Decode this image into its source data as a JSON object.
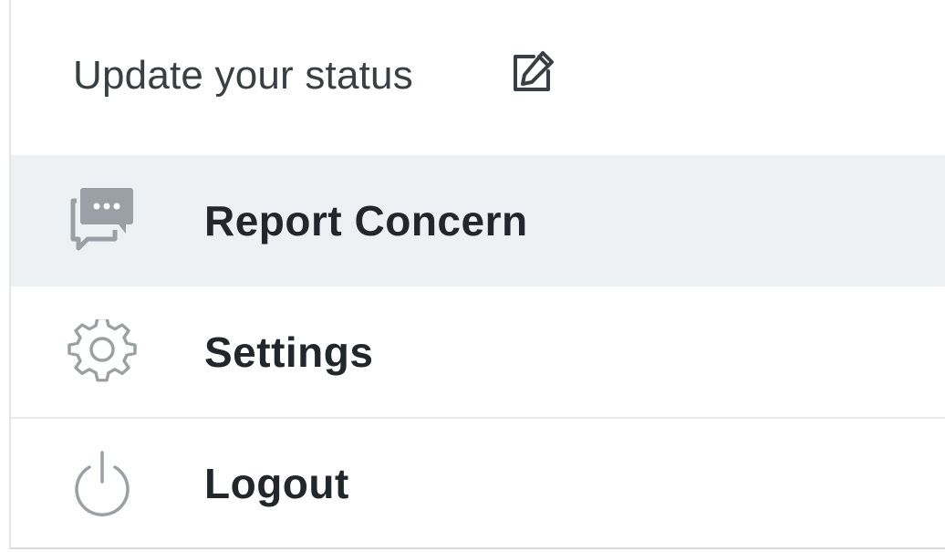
{
  "status": {
    "label": "Update your status",
    "icon": "edit-icon"
  },
  "menu": {
    "items": [
      {
        "label": "Report Concern",
        "icon": "chat-bubbles-icon",
        "active": true
      },
      {
        "label": "Settings",
        "icon": "gear-icon",
        "active": false
      },
      {
        "label": "Logout",
        "icon": "power-icon",
        "active": false
      }
    ]
  },
  "colors": {
    "active_bg": "#eef1f3",
    "icon_gray": "#9aa0a6",
    "label_text": "#23272b",
    "status_text": "#3a3f44"
  }
}
